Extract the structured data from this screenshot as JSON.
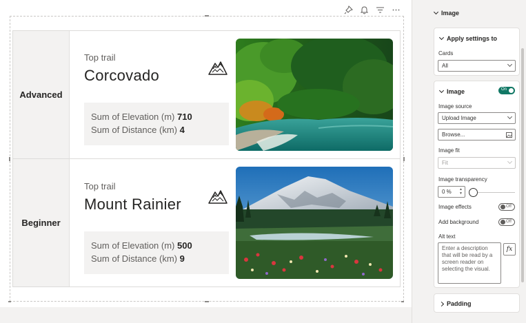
{
  "visual_header": {
    "icons": [
      "pin-icon",
      "bell-icon",
      "filter-icon",
      "more-options-icon"
    ]
  },
  "cards": [
    {
      "category": "Advanced",
      "label": "Top trail",
      "title": "Corcovado",
      "metrics": [
        {
          "name": "Sum of Elevation (m)",
          "value": "710"
        },
        {
          "name": "Sum of Distance (km)",
          "value": "4"
        }
      ],
      "image": "rainforest-lagoon-photo"
    },
    {
      "category": "Beginner",
      "label": "Top trail",
      "title": "Mount Rainier",
      "metrics": [
        {
          "name": "Sum of Elevation (m)",
          "value": "500"
        },
        {
          "name": "Sum of Distance (km)",
          "value": "9"
        }
      ],
      "image": "snowy-mountain-wildflowers-photo"
    }
  ],
  "pane": {
    "image_section": "Image",
    "apply_settings": {
      "title": "Apply settings to",
      "cards_label": "Cards",
      "cards_value": "All"
    },
    "image_card": {
      "title": "Image",
      "toggle": "On",
      "source_label": "Image source",
      "source_value": "Upload Image",
      "browse": "Browse...",
      "fit_label": "Image fit",
      "fit_value": "Fit",
      "transparency_label": "Image transparency",
      "transparency_value": "0 %",
      "transparency_level": 0,
      "effects_label": "Image effects",
      "effects_toggle": "Off",
      "background_label": "Add background",
      "background_toggle": "Off",
      "alt_label": "Alt text",
      "alt_value": "Enter a description that will be read by a screen reader on selecting the visual.",
      "fx_label": "fx"
    },
    "padding": "Padding"
  },
  "colors": {
    "accent": "#117865",
    "category_bg": "#f3f2f1"
  }
}
